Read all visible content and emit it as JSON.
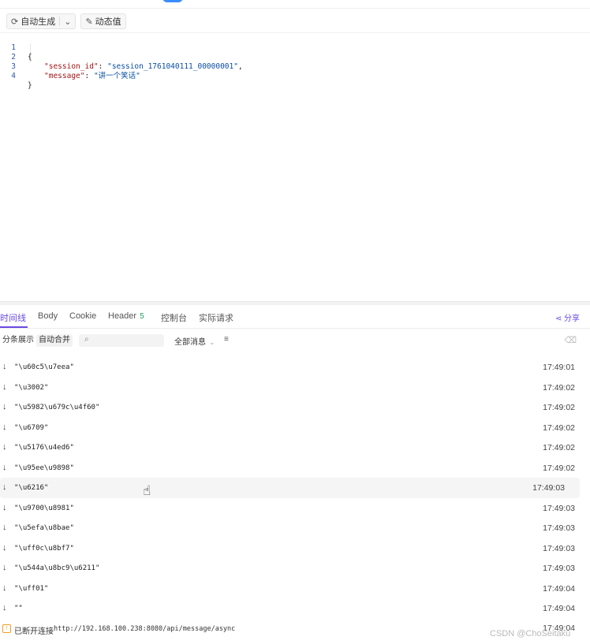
{
  "toolbar": {
    "auto_generate_label": "自动生成",
    "dynamic_value_label": "动态值"
  },
  "editor": {
    "lines": [
      {
        "num": "1",
        "open": "{"
      },
      {
        "num": "2",
        "key": "\"session_id\"",
        "sep": ": ",
        "value": "\"session_1761040111_00000001\"",
        "end": ","
      },
      {
        "num": "3",
        "key": "\"message\"",
        "sep": ": ",
        "value": "\"讲一个笑话\"",
        "end": ""
      },
      {
        "num": "4",
        "close": "}"
      }
    ]
  },
  "tabs": [
    {
      "label": "时间线",
      "active": true
    },
    {
      "label": "Body"
    },
    {
      "label": "Cookie"
    },
    {
      "label": "Header",
      "badge": "5"
    },
    {
      "label": "控制台"
    },
    {
      "label": "实际请求"
    }
  ],
  "share_label": "分享",
  "filters": {
    "split_label": "分条展示",
    "merge_label": "自动合并",
    "search_placeholder": "",
    "all_messages_label": "全部消息"
  },
  "messages": [
    {
      "text": "\"\\u60c5\\u7eea\"",
      "time": "17:49:01"
    },
    {
      "text": "\"\\u3002\"",
      "time": "17:49:02"
    },
    {
      "text": "\"\\u5982\\u679c\\u4f60\"",
      "time": "17:49:02"
    },
    {
      "text": "\"\\u6709\"",
      "time": "17:49:02"
    },
    {
      "text": "\"\\u5176\\u4ed6\"",
      "time": "17:49:02"
    },
    {
      "text": "\"\\u95ee\\u9898\"",
      "time": "17:49:02"
    },
    {
      "text": "\"\\u6216\"",
      "time": "17:49:03",
      "highlighted": true
    },
    {
      "text": "\"\\u9700\\u8981\"",
      "time": "17:49:03"
    },
    {
      "text": "\"\\u5efa\\u8bae\"",
      "time": "17:49:03"
    },
    {
      "text": "\"\\uff0c\\u8bf7\"",
      "time": "17:49:03"
    },
    {
      "text": "\"\\u544a\\u8bc9\\u6211\"",
      "time": "17:49:03"
    },
    {
      "text": "\"\\uff01\"",
      "time": "17:49:04"
    },
    {
      "text": "\"\"",
      "time": "17:49:04"
    }
  ],
  "footer": {
    "status_label": "已断开连接",
    "url": "http://192.168.100.238:8080/api/message/async",
    "time": "17:49:04"
  },
  "watermark": "CSDN @ChoSeitaku",
  "colors": {
    "accent": "#6a4ce0",
    "badge": "#22a06b",
    "warning": "#f0a020"
  }
}
